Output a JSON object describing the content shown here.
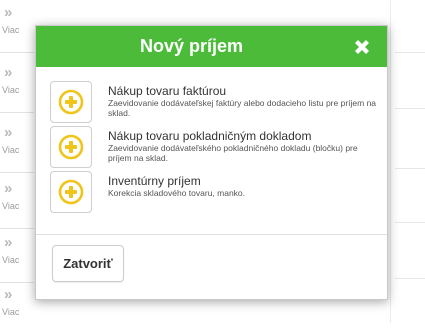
{
  "background": {
    "items": [
      {
        "chevron": "»",
        "label": "Viac"
      },
      {
        "chevron": "»",
        "label": "Viac"
      },
      {
        "chevron": "»",
        "label": "Viac"
      },
      {
        "chevron": "»",
        "label": "Viac"
      },
      {
        "chevron": "»",
        "label": "Viac"
      },
      {
        "chevron": "»",
        "label": "Viac"
      }
    ]
  },
  "modal": {
    "title": "Nový príjem",
    "close_icon": "close-x-icon",
    "options": [
      {
        "icon": "plus-circle-icon",
        "title": "Nákup tovaru faktúrou",
        "description": "Zaevidovanie dodávateľskej faktúry alebo dodacieho listu pre príjem na sklad."
      },
      {
        "icon": "plus-circle-icon",
        "title": "Nákup tovaru pokladničným dokladom",
        "description": "Zaevidovanie dodávateľského pokladničného dokladu (bločku) pre príjem na sklad."
      },
      {
        "icon": "plus-circle-icon",
        "title": "Inventúrny príjem",
        "description": "Korekcia skladového tovaru, manko."
      }
    ],
    "close_button": "Zatvoriť"
  },
  "colors": {
    "header": "#4cbb3a",
    "icon_yellow": "#f0c419"
  }
}
